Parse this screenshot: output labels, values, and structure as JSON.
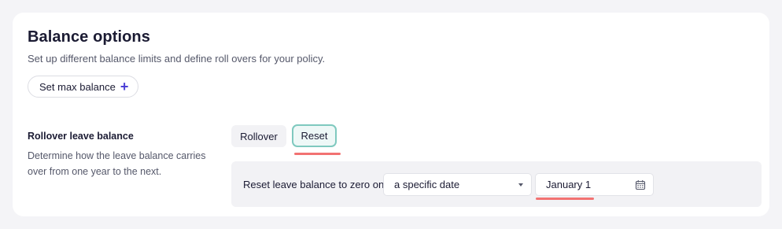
{
  "header": {
    "title": "Balance options",
    "subtitle": "Set up different balance limits and define roll overs for your policy."
  },
  "max_balance_button": {
    "label": "Set max balance",
    "icon": "plus-icon"
  },
  "rollover": {
    "title": "Rollover leave balance",
    "description": "Determine how the leave balance carries over from one year to the next.",
    "options": [
      "Rollover",
      "Reset"
    ],
    "selected": "Reset"
  },
  "reset_panel": {
    "label": "Reset leave balance to zero on",
    "select_value": "a specific date",
    "date_value": "January 1",
    "date_icon": "calendar-icon"
  },
  "colors": {
    "accent": "#4b3fd6",
    "selected_border": "#7fc9bf",
    "annotation_underline": "#f27272"
  }
}
